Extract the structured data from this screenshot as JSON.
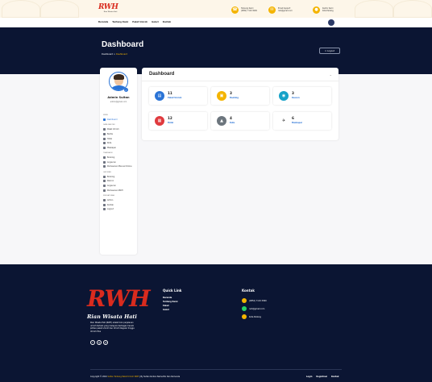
{
  "header": {
    "logo_text": "RWH",
    "logo_subtitle": "Rian Wisata Hati",
    "contacts": [
      {
        "icon": "phone-icon",
        "title": "Hubungi Kami",
        "value": "(0852) 7119 3099"
      },
      {
        "icon": "mail-icon",
        "title": "Email Support",
        "value": "rwh@gmail.com"
      },
      {
        "icon": "location-icon",
        "title": "Kantor Kami",
        "value": "Kota Padang"
      }
    ],
    "nav_links": [
      "Beranda",
      "Tentang Kami",
      "Paket Umroh",
      "Galeri",
      "Kontak"
    ]
  },
  "hero": {
    "title": "Dashboard",
    "breadcrumb_root": "Dashboard",
    "breadcrumb_sep": ">",
    "breadcrumb_current": "Dashboard",
    "logout_label": "Logout"
  },
  "sidebar": {
    "name": "Admin Sultan",
    "email": "admin@gmail.com",
    "sections": [
      {
        "title": "MENU",
        "items": [
          {
            "label": "Dashboard",
            "icon": "grid-icon",
            "active": true
          }
        ]
      },
      {
        "title": "DATA MASTER",
        "items": [
          {
            "label": "Paket Umroh",
            "icon": "package-icon"
          },
          {
            "label": "Berita",
            "icon": "news-icon"
          },
          {
            "label": "Hotel",
            "icon": "hotel-icon"
          },
          {
            "label": "Rute",
            "icon": "route-icon"
          },
          {
            "label": "Maskapai",
            "icon": "plane-icon"
          }
        ]
      },
      {
        "title": "TRANSAKSI",
        "items": [
          {
            "label": "Booking",
            "icon": "booking-icon"
          },
          {
            "label": "Angsuran",
            "icon": "installment-icon"
          },
          {
            "label": "Pemesanan Manual Online",
            "icon": "order-icon"
          }
        ]
      },
      {
        "title": "LAPORAN",
        "items": [
          {
            "label": "Booking",
            "icon": "report-booking-icon"
          },
          {
            "label": "Rescon",
            "icon": "report-rescon-icon"
          },
          {
            "label": "Angsuran",
            "icon": "report-installment-icon"
          },
          {
            "label": "Pemesanan RWH",
            "icon": "report-order-icon"
          }
        ]
      },
      {
        "title": "PENGATURAN",
        "items": [
          {
            "label": "Admin",
            "icon": "admin-icon"
          },
          {
            "label": "Kontak",
            "icon": "contact-icon"
          },
          {
            "label": "Logout",
            "icon": "logout-icon"
          }
        ]
      }
    ]
  },
  "dashboard": {
    "title": "Dashboard",
    "stats": [
      {
        "value": "11",
        "label": "Paket Umroh",
        "icon": "package-icon",
        "color": "#2b74d6"
      },
      {
        "value": "3",
        "label": "Booking",
        "icon": "booking-icon",
        "color": "#f4b400"
      },
      {
        "value": "3",
        "label": "Rescon",
        "icon": "rescon-icon",
        "color": "#17a2c8"
      },
      {
        "value": "12",
        "label": "Hotel",
        "icon": "hotel-icon",
        "color": "#e03a3e"
      },
      {
        "value": "4",
        "label": "Rute",
        "icon": "route-icon",
        "color": "#6c757d"
      },
      {
        "value": "6",
        "label": "Maskapai",
        "icon": "plane-icon",
        "color": "#222222"
      }
    ]
  },
  "footer": {
    "logo_text": "RWH",
    "logo_subtitle": "Rian Wisata Hati",
    "description": "Rian Wisata Hati (RWH) adalah biro perjalanan umroh terbaik yang melayani berbagai macam pilihan paket umroh dan Umroh Reguler hingga Umroh Plus",
    "social": [
      "f",
      "ig",
      "yt"
    ],
    "quick_title": "Quick Link",
    "quick_links": [
      "Beranda",
      "Tentang Kami",
      "Paket",
      "Galeri"
    ],
    "contact_title": "Kontak",
    "contacts": [
      {
        "value": "(0852) 7119 3099",
        "icon": "phone-icon"
      },
      {
        "value": "rwh@gmail.com",
        "icon": "whatsapp-icon"
      },
      {
        "value": "Kota Padang",
        "icon": "location-icon"
      }
    ],
    "copyright_prefix": "Copyright © 2024 ",
    "copyright_brand": "Sultan Tentang Paket Umroh RWH",
    "copyright_suffix": " | By Sultan Kontan Nama Bio Dan Rumanda",
    "bottom_links": [
      "Login",
      "Registrasi",
      "Kontak"
    ]
  },
  "colors": {
    "navy": "#0b1533",
    "accent_yellow": "#f4b400",
    "brand_red": "#d92b1e",
    "link_blue": "#2b74d6"
  }
}
